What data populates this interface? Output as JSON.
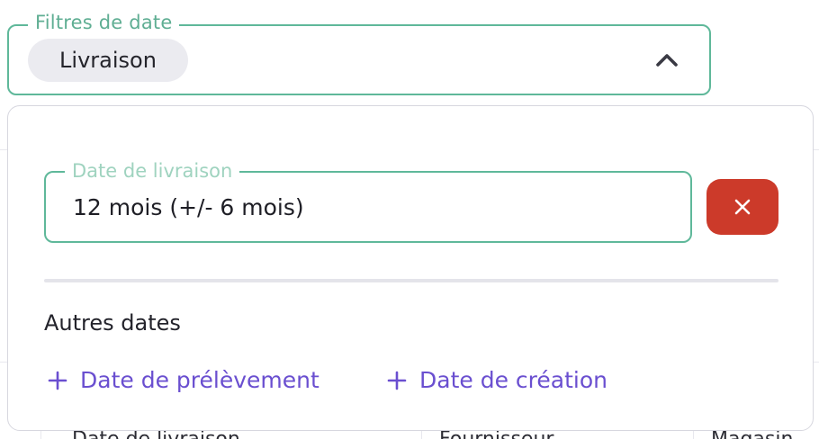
{
  "date_filter": {
    "legend": "Filtres de date",
    "selected_chip": "Livraison",
    "toggle_icon": "chevron-up-icon"
  },
  "panel": {
    "delivery_date": {
      "legend": "Date de livraison",
      "value": "12 mois (+/- 6 mois)",
      "clear_icon": "close-icon"
    },
    "other_dates": {
      "title": "Autres dates",
      "options": [
        {
          "label": "Date de prélèvement",
          "icon": "plus-icon"
        },
        {
          "label": "Date de création",
          "icon": "plus-icon"
        }
      ]
    }
  },
  "background_table": {
    "headers": [
      "Date de livraison",
      "Fournisseur",
      "Magasin"
    ]
  },
  "colors": {
    "accent_green": "#5fb89a",
    "danger_red": "#cc3a2a",
    "link_purple": "#6a4fd0",
    "chip_bg": "#ebebf0"
  }
}
